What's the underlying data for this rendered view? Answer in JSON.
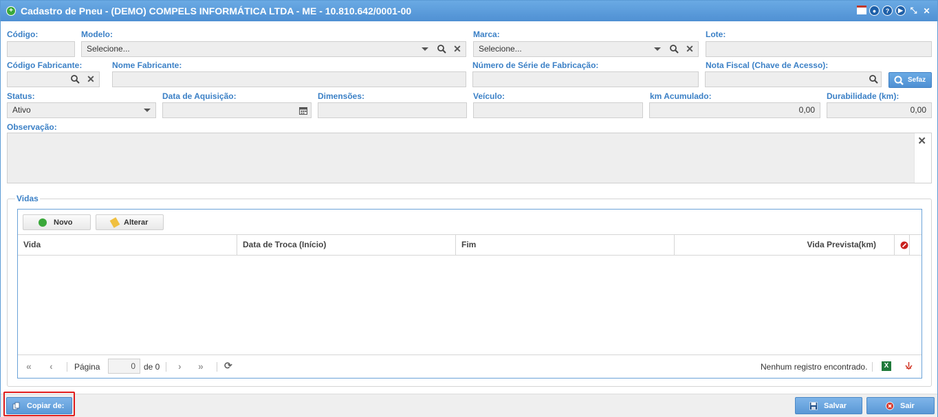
{
  "window": {
    "title": "Cadastro de Pneu - (DEMO) COMPELS INFORMÁTICA LTDA - ME - 10.810.642/0001-00"
  },
  "form": {
    "codigo": {
      "label": "Código:",
      "value": ""
    },
    "modelo": {
      "label": "Modelo:",
      "value": "Selecione..."
    },
    "marca": {
      "label": "Marca:",
      "value": "Selecione..."
    },
    "lote": {
      "label": "Lote:",
      "value": ""
    },
    "codigo_fabricante": {
      "label": "Código Fabricante:",
      "value": ""
    },
    "nome_fabricante": {
      "label": "Nome Fabricante:",
      "value": ""
    },
    "numero_serie": {
      "label": "Número de Série de Fabricação:",
      "value": ""
    },
    "nota_fiscal": {
      "label": "Nota Fiscal (Chave de Acesso):",
      "value": ""
    },
    "sefaz_label": "Sefaz",
    "status": {
      "label": "Status:",
      "value": "Ativo"
    },
    "data_aquisicao": {
      "label": "Data de Aquisição:",
      "value": ""
    },
    "dimensoes": {
      "label": "Dimensões:",
      "value": ""
    },
    "veiculo": {
      "label": "Veículo:",
      "value": ""
    },
    "km_acumulado": {
      "label": "km Acumulado:",
      "value": "0,00"
    },
    "durabilidade": {
      "label": "Durabilidade (km):",
      "value": "0,00"
    },
    "observacao": {
      "label": "Observação:",
      "value": ""
    }
  },
  "vidas": {
    "legend": "Vidas",
    "novo_label": "Novo",
    "alterar_label": "Alterar",
    "columns": [
      "Vida",
      "Data de Troca (Início)",
      "Fim",
      "Vida Prevista(km)"
    ],
    "pager": {
      "page_label": "Página",
      "page_value": "0",
      "of_label": "de 0",
      "empty_message": "Nenhum registro encontrado.",
      "excel_icon": "X",
      "pdf_icon": "⬚"
    }
  },
  "footer": {
    "copiar_label": "Copiar de:",
    "salvar_label": "Salvar",
    "sair_label": "Sair"
  },
  "colors": {
    "accent": "#4f90d3",
    "label": "#3b80c6",
    "highlight": "#e01b1b"
  }
}
